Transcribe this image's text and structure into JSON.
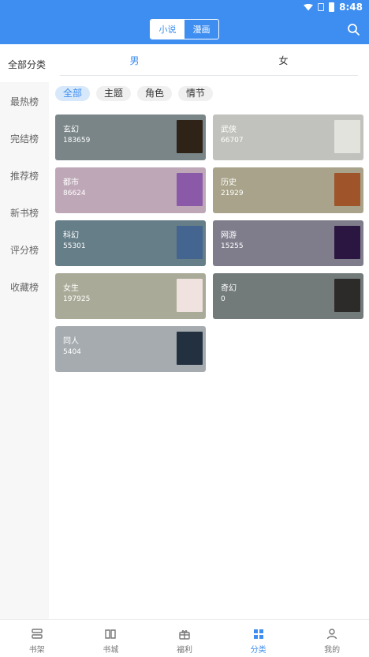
{
  "status": {
    "time": "8:48"
  },
  "header": {
    "tabs": [
      "小说",
      "漫画"
    ]
  },
  "sidebar": {
    "title": "全部分类",
    "items": [
      "最热榜",
      "完结榜",
      "推荐榜",
      "新书榜",
      "评分榜",
      "收藏榜"
    ]
  },
  "gender_tabs": [
    "男",
    "女"
  ],
  "filters": [
    "全部",
    "主题",
    "角色",
    "情节"
  ],
  "categories": [
    {
      "name": "玄幻",
      "count": "183659"
    },
    {
      "name": "武侠",
      "count": "66707"
    },
    {
      "name": "都市",
      "count": "86624"
    },
    {
      "name": "历史",
      "count": "21929"
    },
    {
      "name": "科幻",
      "count": "55301"
    },
    {
      "name": "网游",
      "count": "15255"
    },
    {
      "name": "女生",
      "count": "197925"
    },
    {
      "name": "奇幻",
      "count": "0"
    },
    {
      "name": "同人",
      "count": "5404"
    }
  ],
  "colors": {
    "brand": "#3d8ef0",
    "card_colors": [
      "#7a8588",
      "#c1c2bd",
      "#bea7b7",
      "#a8a38a",
      "#667e88",
      "#7f7d8c",
      "#a9aa97",
      "#737b7a",
      "#a5abaf"
    ],
    "cover_colors": [
      "#2e2316",
      "#e3e3de",
      "#8a5aa8",
      "#a0542a",
      "#43658f",
      "#2a1640",
      "#efe2df",
      "#2d2a2a",
      "#233040"
    ]
  },
  "bottom_nav": [
    "书架",
    "书城",
    "福利",
    "分类",
    "我的"
  ]
}
